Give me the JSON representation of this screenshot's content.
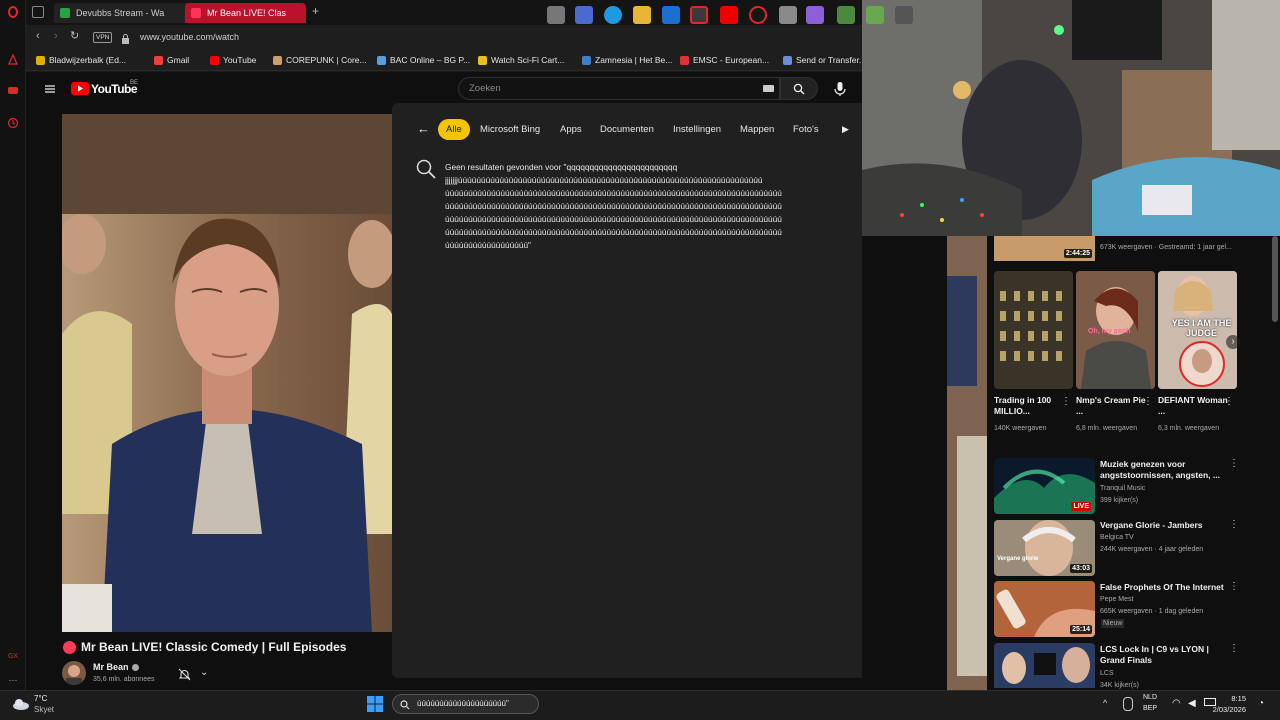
{
  "tabs": [
    {
      "label": "Devubbs Stream - Wa",
      "color": "#2ea043"
    },
    {
      "label": "Mr Bean LIVE! Clas",
      "color": "#e0272c",
      "active": true
    }
  ],
  "address": {
    "url": "www.youtube.com/watch",
    "vpn": "VPN"
  },
  "bookmarks": [
    {
      "label": "Bladwijzerbalk (Ed...",
      "color": "#e0b000"
    },
    {
      "label": "Gmail",
      "color": "#ea4335"
    },
    {
      "label": "YouTube",
      "color": "#ff0000"
    },
    {
      "label": "COREPUNK | Core...",
      "color": "#c9a26b"
    },
    {
      "label": "BAC Online – BG P...",
      "color": "#5aa0d8"
    },
    {
      "label": "Watch Sci-Fi Cart...",
      "color": "#e8c21a"
    },
    {
      "label": "Zamnesia | Het Be...",
      "color": "#3b82c4"
    },
    {
      "label": "EMSC - European...",
      "color": "#d33"
    },
    {
      "label": "Send or Transfer...",
      "color": "#6b8fd6"
    }
  ],
  "youtube": {
    "logo": "YouTube",
    "region": "BE",
    "search_placeholder": "Zoeken",
    "video_title": "Mr Bean LIVE! Classic Comedy | Full Episodes",
    "channel": "Mr Bean",
    "subscribers": "35,6 mln. abonnees"
  },
  "popup": {
    "chips": [
      "Alle",
      "Microsoft Bing",
      "Apps",
      "Documenten",
      "Instellingen",
      "Mappen",
      "Foto's"
    ],
    "no_results_line1": "Geen resultaten gevonden voor \"qqqqqqqqqqqqqqqqqqqqqqqq",
    "no_results_line2": "jjjjjjjúúúúúúúúúúúúúúúúúúúúúúúúúúúúúúúúúúúúúúúúúúúúúúúúúúúúúúúúúúúúúúúúúú",
    "no_results_line3": "úúúúúúúúúúúúúúúúúúúúúúúúúúúúúúúúúúúúúúúúúúúúúúúúúúúúúúúúúúúúúúúúúúúúúúúúú",
    "no_results_line4": "úúúúúúúúúúúúúúúúúúúúúúúúúúúúúúúúúúúúúúúúúúúúúúúúúúúúúúúúúúúúúúúúúúúúúúúúú",
    "no_results_line5": "úúúúúúúúúúúúúúúúúúúúúúúúúúúúúúúúúúúúúúúúúúúúúúúúúúúúúúúúúúúúúúúúúúúúúúúúú",
    "no_results_line6": "úúúúúúúúúúúúúúúúúúúúúúúúúúúúúúúúúúúúúúúúúúúúúúúúúúúúúúúúúúúúúúúúúúúúúúúúú",
    "no_results_line7": "úúúúúúúúúúúúúúúúúú\""
  },
  "sidebar": {
    "top_item": {
      "meta": "673K weergaven · Gestreamd: 1 jaar gel...",
      "duration": "2:44:25"
    },
    "shorts": [
      {
        "title": "Trading in 100 MILLIO...",
        "views": "140K weergaven"
      },
      {
        "title": "Nmp's Cream Pie ...",
        "views": "6,8 mln. weergaven"
      },
      {
        "title": "DEFIANT Woman ...",
        "views": "6,3 mln. weergaven"
      }
    ],
    "short_overlay_1": "Oh, my gosh",
    "short_overlay_2": "YES I AM THE JUDGE",
    "videos": [
      {
        "title": "Muziek genezen voor angststoornissen, angsten, ...",
        "channel": "Tranquil Music",
        "meta": "399 kijker(s)",
        "badge": "LIVE"
      },
      {
        "title": "Vergane Glorie - Jambers",
        "channel": "Belgica TV",
        "meta": "244K weergaven · 4 jaar geleden",
        "duration": "43:03",
        "thumb_text": "Vergane glorie"
      },
      {
        "title": "False Prophets Of The Internet",
        "channel": "Pepe Mest",
        "meta": "665K weergaven · 1 dag geleden",
        "extra": "Nieuw",
        "duration": "25:14"
      },
      {
        "title": "LCS Lock In | C9 vs LYON | Grand Finals",
        "channel": "LCS",
        "meta": "34K kijker(s)"
      }
    ]
  },
  "taskbar": {
    "weather_temp": "7°C",
    "weather_desc": "Skyet",
    "search_text": "úúúúúúúúúúúúúúúúúúúú\"",
    "lang1": "NLD",
    "lang2": "BEP",
    "time": "8:15",
    "date": "2/03/2026"
  }
}
